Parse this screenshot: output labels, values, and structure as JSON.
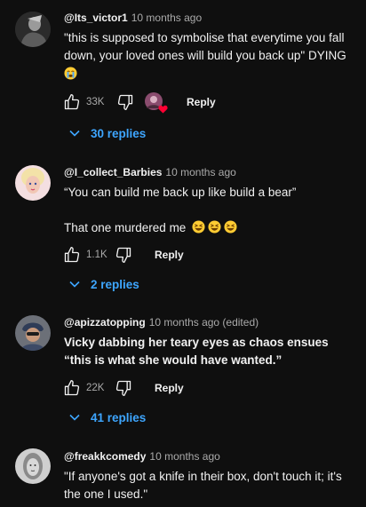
{
  "comments": [
    {
      "handle": "@Its_victor1",
      "time": "10 months ago",
      "text_lines": [
        "\"this is supposed to symbolise that everytime you fall down, your loved ones will build you back up\" DYING"
      ],
      "likes": "33K",
      "reply_label": "Reply",
      "replies_label": "30 replies",
      "avatar_color": "#2b2b2b"
    },
    {
      "handle": "@I_collect_Barbies",
      "time": "10 months ago",
      "text_lines": [
        "“You can build me back up like build a bear”",
        "That one murdered me"
      ],
      "likes": "1.1K",
      "reply_label": "Reply",
      "replies_label": "2 replies",
      "avatar_color": "#f2d6c9"
    },
    {
      "handle": "@apizzatopping",
      "time": "10 months ago (edited)",
      "text_lines": [
        "Vicky dabbing her teary eyes as chaos ensues “this is what she would have wanted.”"
      ],
      "likes": "22K",
      "reply_label": "Reply",
      "replies_label": "41 replies",
      "avatar_color": "#5a5f66"
    },
    {
      "handle": "@freakkcomedy",
      "time": "10 months ago",
      "text_lines": [
        "\"If anyone's got a knife in their box, don't touch it; it's the one I used.\""
      ],
      "avatar_color": "#8a8a8a"
    }
  ],
  "colors": {
    "background": "#0f0f0f",
    "text": "#f1f1f1",
    "secondary_text": "#aaaaaa",
    "link_blue": "#3ea6ff",
    "creator_heart": "#ff0033"
  },
  "icons": {
    "like": "thumbs-up-icon",
    "dislike": "thumbs-down-icon",
    "expand": "chevron-down-icon",
    "creator_heart": "heart-icon",
    "emoji_crying": "loudly-crying-face-emoji",
    "emoji_laughing": "grinning-squinting-face-emoji"
  }
}
